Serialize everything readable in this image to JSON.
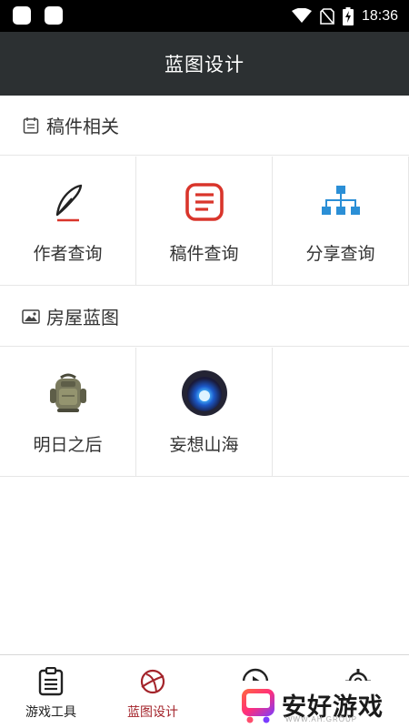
{
  "status_bar": {
    "time": "18:36"
  },
  "app_bar": {
    "title": "蓝图设计"
  },
  "sections": [
    {
      "title": "稿件相关",
      "icon": "document-list-icon",
      "items": [
        {
          "label": "作者查询",
          "icon": "pen-icon",
          "color": "#d9352b"
        },
        {
          "label": "稿件查询",
          "icon": "manuscript-icon",
          "color": "#d9352b"
        },
        {
          "label": "分享查询",
          "icon": "share-tree-icon",
          "color": "#2b8fd6"
        }
      ]
    },
    {
      "title": "房屋蓝图",
      "icon": "image-icon",
      "items": [
        {
          "label": "明日之后",
          "icon": "backpack-icon"
        },
        {
          "label": "妄想山海",
          "icon": "blue-orb-icon"
        }
      ]
    }
  ],
  "bottom_nav": [
    {
      "label": "游戏工具",
      "icon": "clipboard-icon",
      "active": false
    },
    {
      "label": "蓝图设计",
      "icon": "planet-icon",
      "active": true
    },
    {
      "label": "",
      "icon": "play-icon",
      "active": false
    },
    {
      "label": "",
      "icon": "gear-icon",
      "active": false
    }
  ],
  "watermark": {
    "text": "安好游戏",
    "sub": "WWW.AH.GROUP"
  },
  "colors": {
    "app_bar": "#2c3032",
    "accent_red": "#d9352b",
    "accent_blue": "#2b8fd6",
    "nav_active": "#a3232a"
  }
}
